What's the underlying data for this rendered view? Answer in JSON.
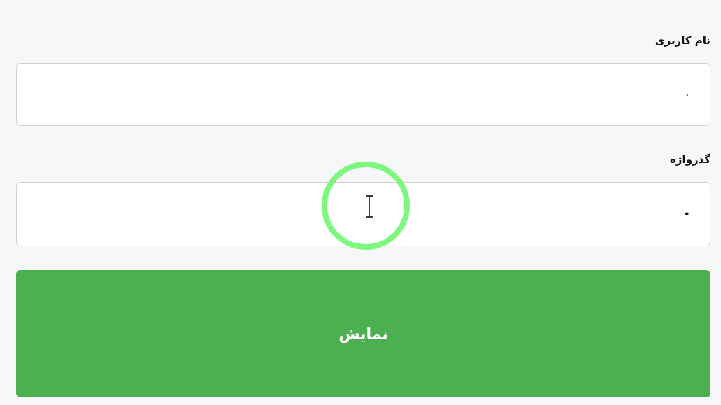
{
  "fields": [
    {
      "label": "نام کاربری",
      "value": "۰"
    },
    {
      "label": "گذرواژه",
      "value": "•"
    }
  ],
  "submit_button": {
    "label": "نمایش"
  }
}
